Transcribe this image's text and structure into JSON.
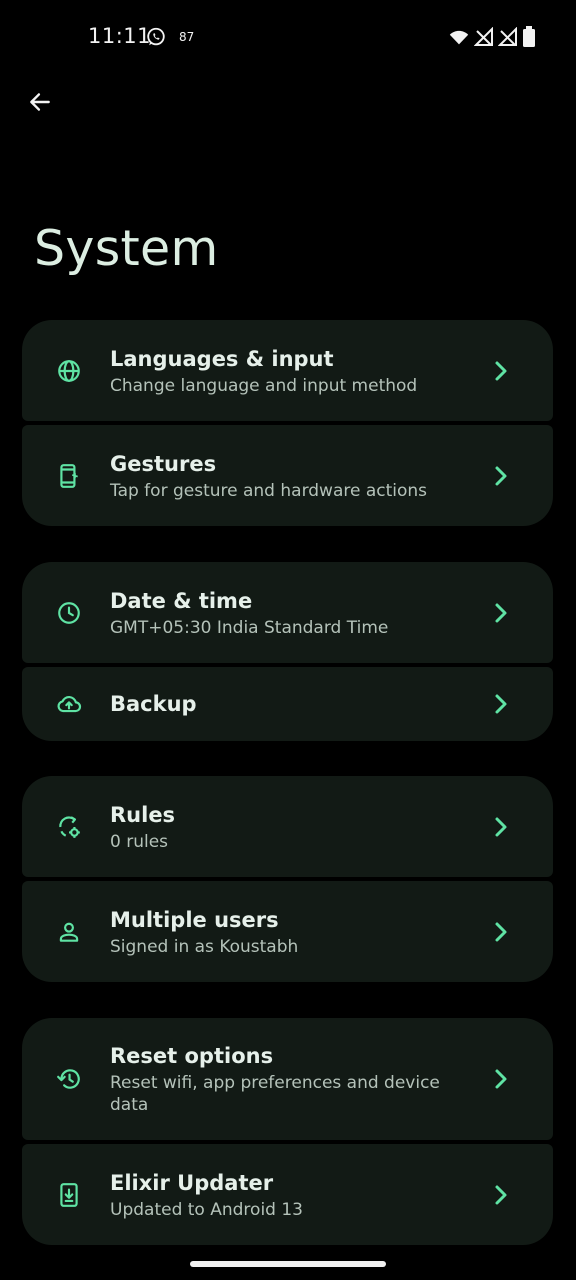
{
  "status_bar": {
    "time": "11:11",
    "notification_count": "87"
  },
  "header": {
    "title": "System"
  },
  "colors": {
    "accent": "#5fe3a4",
    "card_background": "#121a15",
    "background": "#000000"
  },
  "items": [
    {
      "title": "Languages & input",
      "subtitle": "Change language and input method",
      "icon": "globe-icon"
    },
    {
      "title": "Gestures",
      "subtitle": "Tap for gesture and hardware actions",
      "icon": "phone-gesture-icon"
    },
    {
      "title": "Date & time",
      "subtitle": "GMT+05:30 India Standard Time",
      "icon": "clock-icon"
    },
    {
      "title": "Backup",
      "subtitle": "",
      "icon": "cloud-upload-icon"
    },
    {
      "title": "Rules",
      "subtitle": "0 rules",
      "icon": "rules-sync-icon"
    },
    {
      "title": "Multiple users",
      "subtitle": "Signed in as Koustabh",
      "icon": "person-icon"
    },
    {
      "title": "Reset options",
      "subtitle": "Reset wifi, app preferences and device data",
      "icon": "history-icon"
    },
    {
      "title": "Elixir Updater",
      "subtitle": "Updated to Android 13",
      "icon": "system-update-icon"
    }
  ]
}
